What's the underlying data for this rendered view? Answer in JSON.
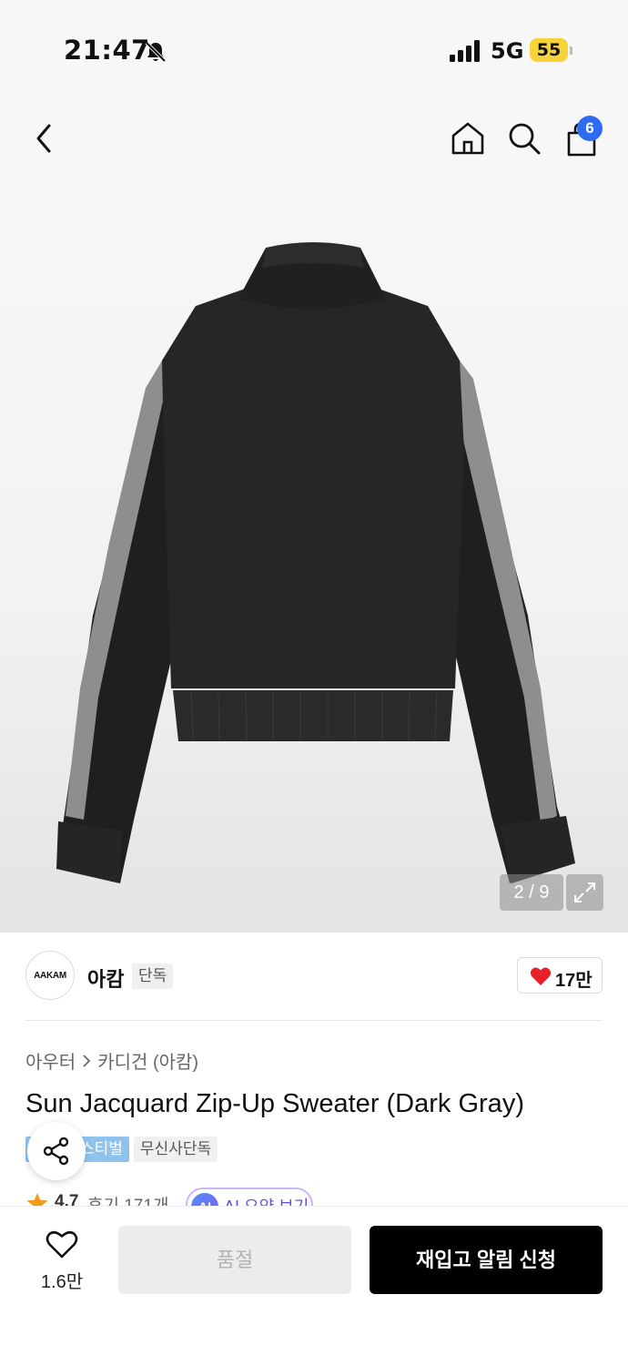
{
  "status_bar": {
    "time": "21:47",
    "network": "5G",
    "battery": "55",
    "battery_color": "#f6d33a"
  },
  "nav": {
    "cart_count": "6",
    "icons": [
      "back-icon",
      "home-icon",
      "search-icon",
      "bag-icon"
    ]
  },
  "gallery": {
    "counter": "2 / 9"
  },
  "brand": {
    "logo_text": "AAKAM",
    "name": "아캄",
    "tag": "단독",
    "likes": "17만"
  },
  "product": {
    "breadcrumb": [
      "아우터",
      "카디건 (아캄)"
    ],
    "title": "Sun Jacquard Zip-Up Sweater (Dark Gray)",
    "tags": {
      "festival": "스티벌",
      "exclusive": "무신사단독"
    },
    "rating": "4.7",
    "reviews": "후기 171개",
    "ai_badge": "AI",
    "ai_summary": "AI 요약 보기"
  },
  "bottom_bar": {
    "wish_count": "1.6만",
    "soldout_label": "품절",
    "restock_label": "재입고 알림 신청"
  },
  "colors": {
    "accent_blue": "#2b6cf0",
    "heart_red": "#e8202a",
    "festival_tag": "#8fc2ec",
    "ai_purple": "#6a4ce0"
  }
}
